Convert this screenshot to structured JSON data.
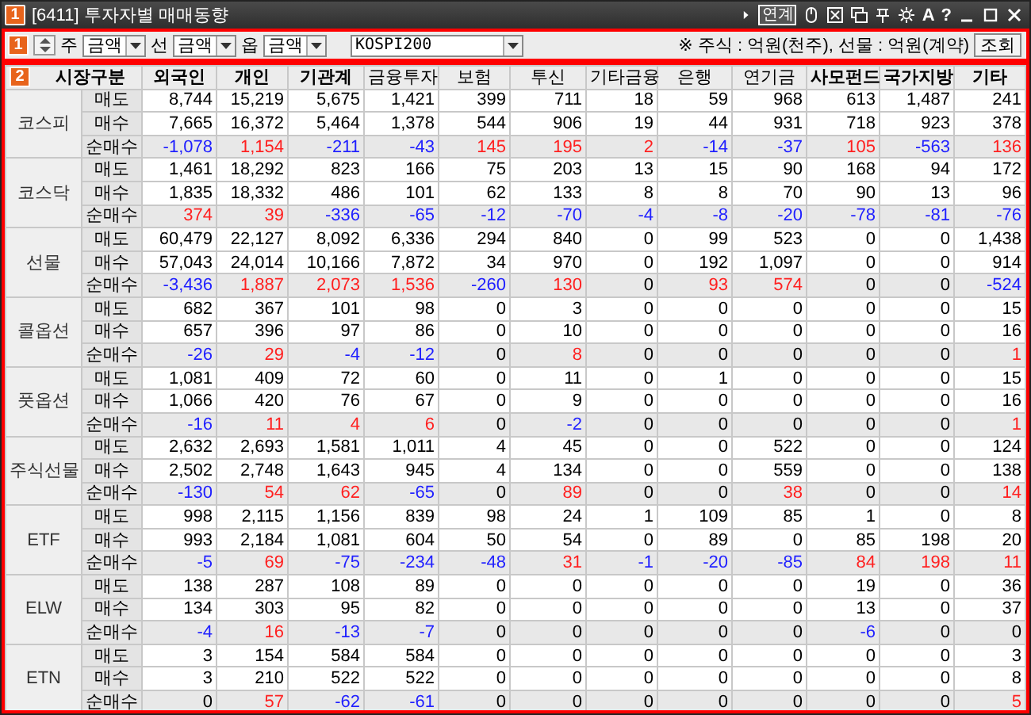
{
  "title_bar": {
    "badge": "1",
    "title": "[6411] 투자자별 매매동향",
    "link_button": "연계",
    "letter_buttons": [
      "A",
      "?"
    ]
  },
  "toolbar": {
    "badge": "1",
    "selects": [
      {
        "label": "주",
        "value": "금액"
      },
      {
        "label": "선",
        "value": "금액"
      },
      {
        "label": "옵",
        "value": "금액"
      }
    ],
    "market": "KOSPI200",
    "note_mark": "※",
    "note": "주식 : 억원(천주), 선물 : 억원(계약)",
    "button": "조회"
  },
  "table": {
    "badge": "2",
    "corner": "시장구분",
    "columns": [
      {
        "label": "외국인",
        "bold": true
      },
      {
        "label": "개인",
        "bold": true
      },
      {
        "label": "기관계",
        "bold": true
      },
      {
        "label": "금융투자",
        "bold": false
      },
      {
        "label": "보험",
        "bold": false
      },
      {
        "label": "투신",
        "bold": false
      },
      {
        "label": "기타금융",
        "bold": false
      },
      {
        "label": "은행",
        "bold": false
      },
      {
        "label": "연기금",
        "bold": false
      },
      {
        "label": "사모펀드",
        "bold": true
      },
      {
        "label": "국가지방",
        "bold": true
      },
      {
        "label": "기타",
        "bold": true
      }
    ],
    "groups": [
      {
        "name": "코스피",
        "rows": [
          {
            "label": "매도",
            "kind": "trade",
            "values": [
              "8,744",
              "15,219",
              "5,675",
              "1,421",
              "399",
              "711",
              "18",
              "59",
              "968",
              "613",
              "1,487",
              "241"
            ]
          },
          {
            "label": "매수",
            "kind": "trade",
            "values": [
              "7,665",
              "16,372",
              "5,464",
              "1,378",
              "544",
              "906",
              "19",
              "44",
              "931",
              "718",
              "923",
              "378"
            ]
          },
          {
            "label": "순매수",
            "kind": "net",
            "cells": [
              {
                "text": "-1,078",
                "color": "#2020ff"
              },
              {
                "text": "1,154",
                "color": "#ff2020"
              },
              {
                "text": "-211",
                "color": "#2020ff"
              },
              {
                "text": "-43",
                "color": "#2020ff"
              },
              {
                "text": "145",
                "color": "#ff2020"
              },
              {
                "text": "195",
                "color": "#ff2020"
              },
              {
                "text": "2",
                "color": "#ff2020"
              },
              {
                "text": "-14",
                "color": "#2020ff"
              },
              {
                "text": "-37",
                "color": "#2020ff"
              },
              {
                "text": "105",
                "color": "#ff2020"
              },
              {
                "text": "-563",
                "color": "#2020ff"
              },
              {
                "text": "136",
                "color": "#ff2020"
              }
            ]
          }
        ]
      },
      {
        "name": "코스닥",
        "rows": [
          {
            "label": "매도",
            "kind": "trade",
            "values": [
              "1,461",
              "18,292",
              "823",
              "166",
              "75",
              "203",
              "13",
              "15",
              "90",
              "168",
              "94",
              "172"
            ]
          },
          {
            "label": "매수",
            "kind": "trade",
            "values": [
              "1,835",
              "18,332",
              "486",
              "101",
              "62",
              "133",
              "8",
              "8",
              "70",
              "90",
              "13",
              "96"
            ]
          },
          {
            "label": "순매수",
            "kind": "net",
            "cells": [
              {
                "text": "374",
                "color": "#ff2020"
              },
              {
                "text": "39",
                "color": "#ff2020"
              },
              {
                "text": "-336",
                "color": "#2020ff"
              },
              {
                "text": "-65",
                "color": "#2020ff"
              },
              {
                "text": "-12",
                "color": "#2020ff"
              },
              {
                "text": "-70",
                "color": "#2020ff"
              },
              {
                "text": "-4",
                "color": "#2020ff"
              },
              {
                "text": "-8",
                "color": "#2020ff"
              },
              {
                "text": "-20",
                "color": "#2020ff"
              },
              {
                "text": "-78",
                "color": "#2020ff"
              },
              {
                "text": "-81",
                "color": "#2020ff"
              },
              {
                "text": "-76",
                "color": "#2020ff"
              }
            ]
          }
        ]
      },
      {
        "name": "선물",
        "rows": [
          {
            "label": "매도",
            "kind": "trade",
            "values": [
              "60,479",
              "22,127",
              "8,092",
              "6,336",
              "294",
              "840",
              "0",
              "99",
              "523",
              "0",
              "0",
              "1,438"
            ]
          },
          {
            "label": "매수",
            "kind": "trade",
            "values": [
              "57,043",
              "24,014",
              "10,166",
              "7,872",
              "34",
              "970",
              "0",
              "192",
              "1,097",
              "0",
              "0",
              "914"
            ]
          },
          {
            "label": "순매수",
            "kind": "net",
            "cells": [
              {
                "text": "-3,436",
                "color": "#2020ff"
              },
              {
                "text": "1,887",
                "color": "#ff2020"
              },
              {
                "text": "2,073",
                "color": "#ff2020"
              },
              {
                "text": "1,536",
                "color": "#ff2020"
              },
              {
                "text": "-260",
                "color": "#2020ff"
              },
              {
                "text": "130",
                "color": "#ff2020"
              },
              {
                "text": "0",
                "color": "#000000"
              },
              {
                "text": "93",
                "color": "#ff2020"
              },
              {
                "text": "574",
                "color": "#ff2020"
              },
              {
                "text": "0",
                "color": "#000000"
              },
              {
                "text": "0",
                "color": "#000000"
              },
              {
                "text": "-524",
                "color": "#2020ff"
              }
            ]
          }
        ]
      },
      {
        "name": "콜옵션",
        "rows": [
          {
            "label": "매도",
            "kind": "trade",
            "values": [
              "682",
              "367",
              "101",
              "98",
              "0",
              "3",
              "0",
              "0",
              "0",
              "0",
              "0",
              "15"
            ]
          },
          {
            "label": "매수",
            "kind": "trade",
            "values": [
              "657",
              "396",
              "97",
              "86",
              "0",
              "10",
              "0",
              "0",
              "0",
              "0",
              "0",
              "16"
            ]
          },
          {
            "label": "순매수",
            "kind": "net",
            "cells": [
              {
                "text": "-26",
                "color": "#2020ff"
              },
              {
                "text": "29",
                "color": "#ff2020"
              },
              {
                "text": "-4",
                "color": "#2020ff"
              },
              {
                "text": "-12",
                "color": "#2020ff"
              },
              {
                "text": "0",
                "color": "#000000"
              },
              {
                "text": "8",
                "color": "#ff2020"
              },
              {
                "text": "0",
                "color": "#000000"
              },
              {
                "text": "0",
                "color": "#000000"
              },
              {
                "text": "0",
                "color": "#000000"
              },
              {
                "text": "0",
                "color": "#000000"
              },
              {
                "text": "0",
                "color": "#000000"
              },
              {
                "text": "1",
                "color": "#ff2020"
              }
            ]
          }
        ]
      },
      {
        "name": "풋옵션",
        "rows": [
          {
            "label": "매도",
            "kind": "trade",
            "values": [
              "1,081",
              "409",
              "72",
              "60",
              "0",
              "11",
              "0",
              "1",
              "0",
              "0",
              "0",
              "15"
            ]
          },
          {
            "label": "매수",
            "kind": "trade",
            "values": [
              "1,066",
              "420",
              "76",
              "67",
              "0",
              "9",
              "0",
              "0",
              "0",
              "0",
              "0",
              "16"
            ]
          },
          {
            "label": "순매수",
            "kind": "net",
            "cells": [
              {
                "text": "-16",
                "color": "#2020ff"
              },
              {
                "text": "11",
                "color": "#ff2020"
              },
              {
                "text": "4",
                "color": "#ff2020"
              },
              {
                "text": "6",
                "color": "#ff2020"
              },
              {
                "text": "0",
                "color": "#000000"
              },
              {
                "text": "-2",
                "color": "#2020ff"
              },
              {
                "text": "0",
                "color": "#000000"
              },
              {
                "text": "0",
                "color": "#000000"
              },
              {
                "text": "0",
                "color": "#000000"
              },
              {
                "text": "0",
                "color": "#000000"
              },
              {
                "text": "0",
                "color": "#000000"
              },
              {
                "text": "1",
                "color": "#ff2020"
              }
            ]
          }
        ]
      },
      {
        "name": "주식선물",
        "rows": [
          {
            "label": "매도",
            "kind": "trade",
            "values": [
              "2,632",
              "2,693",
              "1,581",
              "1,011",
              "4",
              "45",
              "0",
              "0",
              "522",
              "0",
              "0",
              "124"
            ]
          },
          {
            "label": "매수",
            "kind": "trade",
            "values": [
              "2,502",
              "2,748",
              "1,643",
              "945",
              "4",
              "134",
              "0",
              "0",
              "559",
              "0",
              "0",
              "138"
            ]
          },
          {
            "label": "순매수",
            "kind": "net",
            "cells": [
              {
                "text": "-130",
                "color": "#2020ff"
              },
              {
                "text": "54",
                "color": "#ff2020"
              },
              {
                "text": "62",
                "color": "#ff2020"
              },
              {
                "text": "-65",
                "color": "#2020ff"
              },
              {
                "text": "0",
                "color": "#000000"
              },
              {
                "text": "89",
                "color": "#ff2020"
              },
              {
                "text": "0",
                "color": "#000000"
              },
              {
                "text": "0",
                "color": "#000000"
              },
              {
                "text": "38",
                "color": "#ff2020"
              },
              {
                "text": "0",
                "color": "#000000"
              },
              {
                "text": "0",
                "color": "#000000"
              },
              {
                "text": "14",
                "color": "#ff2020"
              }
            ]
          }
        ]
      },
      {
        "name": "ETF",
        "rows": [
          {
            "label": "매도",
            "kind": "trade",
            "values": [
              "998",
              "2,115",
              "1,156",
              "839",
              "98",
              "24",
              "1",
              "109",
              "85",
              "1",
              "0",
              "8"
            ]
          },
          {
            "label": "매수",
            "kind": "trade",
            "values": [
              "993",
              "2,184",
              "1,081",
              "604",
              "50",
              "54",
              "0",
              "89",
              "0",
              "85",
              "198",
              "20"
            ]
          },
          {
            "label": "순매수",
            "kind": "net",
            "cells": [
              {
                "text": "-5",
                "color": "#2020ff"
              },
              {
                "text": "69",
                "color": "#ff2020"
              },
              {
                "text": "-75",
                "color": "#2020ff"
              },
              {
                "text": "-234",
                "color": "#2020ff"
              },
              {
                "text": "-48",
                "color": "#2020ff"
              },
              {
                "text": "31",
                "color": "#ff2020"
              },
              {
                "text": "-1",
                "color": "#2020ff"
              },
              {
                "text": "-20",
                "color": "#2020ff"
              },
              {
                "text": "-85",
                "color": "#2020ff"
              },
              {
                "text": "84",
                "color": "#ff2020"
              },
              {
                "text": "198",
                "color": "#ff2020"
              },
              {
                "text": "11",
                "color": "#ff2020"
              }
            ]
          }
        ]
      },
      {
        "name": "ELW",
        "rows": [
          {
            "label": "매도",
            "kind": "trade",
            "values": [
              "138",
              "287",
              "108",
              "89",
              "0",
              "0",
              "0",
              "0",
              "0",
              "19",
              "0",
              "36"
            ]
          },
          {
            "label": "매수",
            "kind": "trade",
            "values": [
              "134",
              "303",
              "95",
              "82",
              "0",
              "0",
              "0",
              "0",
              "0",
              "13",
              "0",
              "37"
            ]
          },
          {
            "label": "순매수",
            "kind": "net",
            "cells": [
              {
                "text": "-4",
                "color": "#2020ff"
              },
              {
                "text": "16",
                "color": "#ff2020"
              },
              {
                "text": "-13",
                "color": "#2020ff"
              },
              {
                "text": "-7",
                "color": "#2020ff"
              },
              {
                "text": "0",
                "color": "#000000"
              },
              {
                "text": "0",
                "color": "#000000"
              },
              {
                "text": "0",
                "color": "#000000"
              },
              {
                "text": "0",
                "color": "#000000"
              },
              {
                "text": "0",
                "color": "#000000"
              },
              {
                "text": "-6",
                "color": "#2020ff"
              },
              {
                "text": "0",
                "color": "#000000"
              },
              {
                "text": "0",
                "color": "#000000"
              }
            ]
          }
        ]
      },
      {
        "name": "ETN",
        "rows": [
          {
            "label": "매도",
            "kind": "trade",
            "values": [
              "3",
              "154",
              "584",
              "584",
              "0",
              "0",
              "0",
              "0",
              "0",
              "0",
              "0",
              "3"
            ]
          },
          {
            "label": "매수",
            "kind": "trade",
            "values": [
              "3",
              "210",
              "522",
              "522",
              "0",
              "0",
              "0",
              "0",
              "0",
              "0",
              "0",
              "8"
            ]
          },
          {
            "label": "순매수",
            "kind": "net",
            "cells": [
              {
                "text": "0",
                "color": "#000000"
              },
              {
                "text": "57",
                "color": "#ff2020"
              },
              {
                "text": "-62",
                "color": "#2020ff"
              },
              {
                "text": "-61",
                "color": "#2020ff"
              },
              {
                "text": "0",
                "color": "#000000"
              },
              {
                "text": "0",
                "color": "#000000"
              },
              {
                "text": "0",
                "color": "#000000"
              },
              {
                "text": "0",
                "color": "#000000"
              },
              {
                "text": "0",
                "color": "#000000"
              },
              {
                "text": "0",
                "color": "#000000"
              },
              {
                "text": "0",
                "color": "#000000"
              },
              {
                "text": "5",
                "color": "#ff2020"
              }
            ]
          }
        ]
      }
    ]
  }
}
